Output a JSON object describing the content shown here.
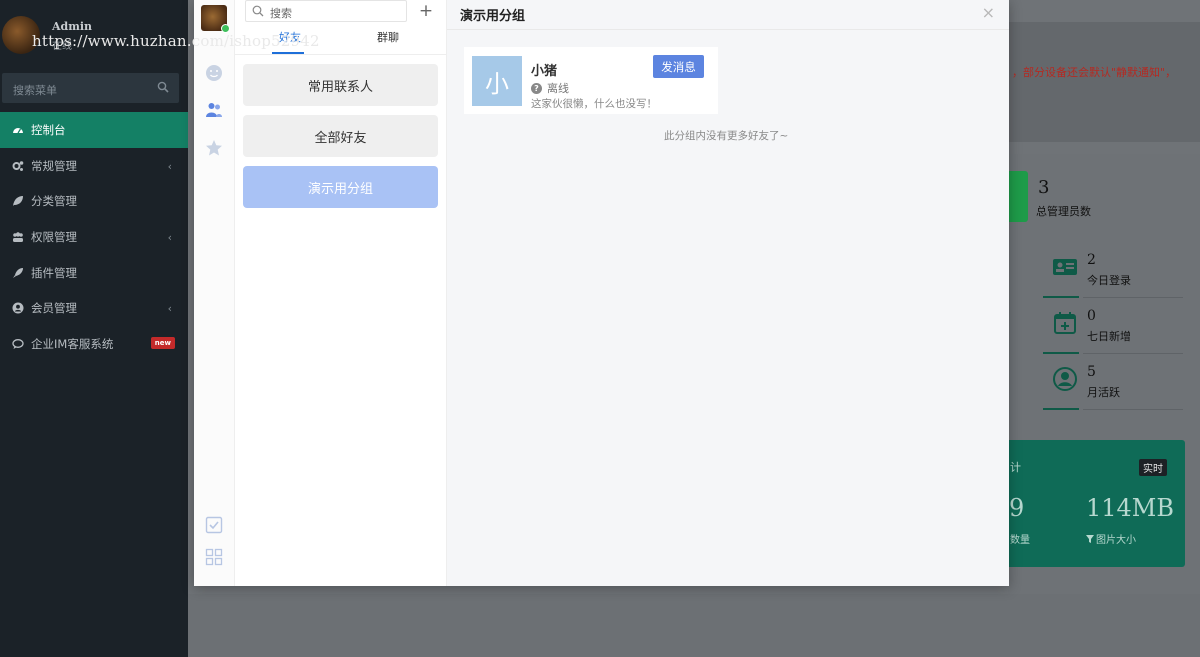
{
  "watermark": "https://www.huzhan.com/ishop52942",
  "sidebar": {
    "user_name": "Admin",
    "user_status": "在线",
    "search_placeholder": "搜索菜单",
    "menu": [
      {
        "label": "控制台",
        "icon": "dashboard-icon",
        "active": true
      },
      {
        "label": "常规管理",
        "icon": "cogs-icon",
        "chevron": "‹"
      },
      {
        "label": "分类管理",
        "icon": "leaf-icon"
      },
      {
        "label": "权限管理",
        "icon": "group-icon",
        "chevron": "‹"
      },
      {
        "label": "插件管理",
        "icon": "rocket-icon"
      },
      {
        "label": "会员管理",
        "icon": "user-circle-icon",
        "chevron": "‹"
      },
      {
        "label": "企业IM客服系统",
        "icon": "comment-icon",
        "badge": "new"
      }
    ]
  },
  "dashboard": {
    "notice": "，部分设备还会默认\"静默通知\"，",
    "admin_count": "3",
    "admin_count_label": "总管理员数",
    "stats": [
      {
        "value": "2",
        "label": "今日登录",
        "icon": "id-card-icon"
      },
      {
        "value": "0",
        "label": "七日新增",
        "icon": "calendar-plus-icon"
      },
      {
        "value": "5",
        "label": "月活跃",
        "icon": "user-circle-icon"
      }
    ],
    "teal_title": "计",
    "live_badge": "实时",
    "teal_left_value": "9",
    "teal_left_label": "数量",
    "teal_right_value": "114MB",
    "teal_right_label": "图片大小"
  },
  "im": {
    "search_placeholder": "搜索",
    "add_symbol": "+",
    "tabs": [
      {
        "label": "好友",
        "active": true
      },
      {
        "label": "群聊"
      }
    ],
    "groups": [
      {
        "label": "常用联系人"
      },
      {
        "label": "全部好友"
      },
      {
        "label": "演示用分组",
        "active": true
      }
    ],
    "title": "演示用分组",
    "close_symbol": "×",
    "friend": {
      "avatar_char": "小",
      "name": "小猪",
      "status": "离线",
      "signature": "这家伙很懒，什么也没写！",
      "message_button": "发消息"
    },
    "no_more_text": "此分组内没有更多好友了~"
  },
  "colors": {
    "sidebar_bg": "#1b2228",
    "active_menu": "#148065",
    "im_active_group": "#a9c2f5",
    "send_button": "#5c84e0",
    "tab_active": "#1e6fd9"
  }
}
